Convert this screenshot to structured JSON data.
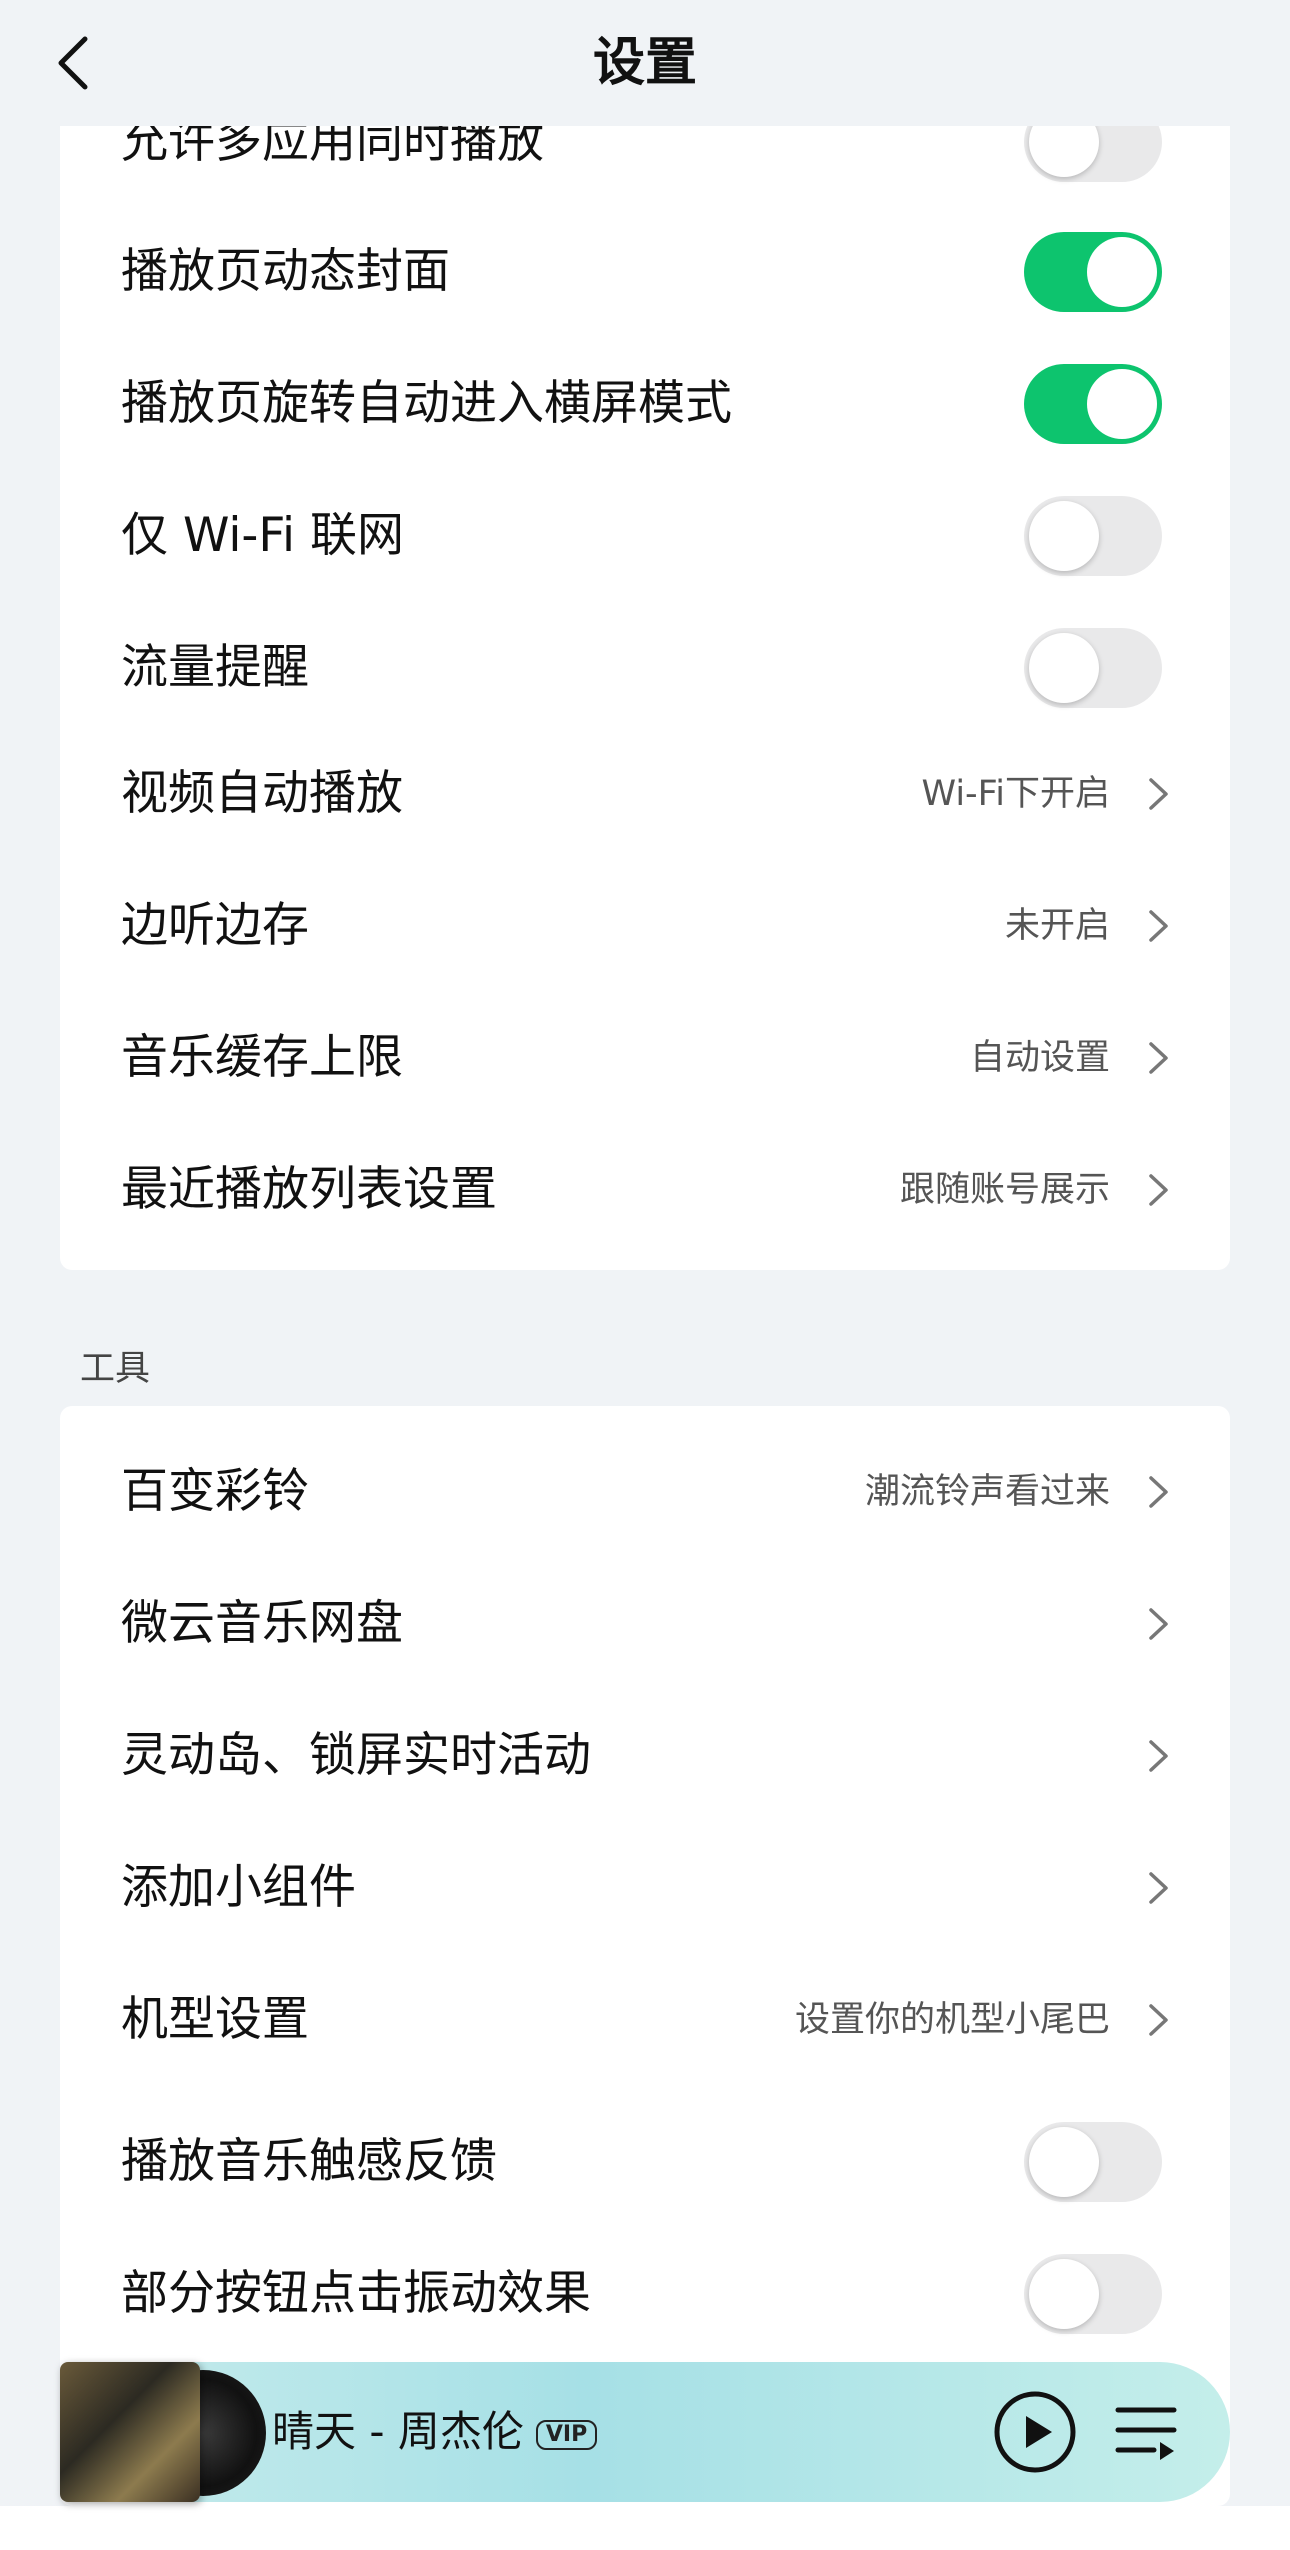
{
  "header": {
    "title": "设置"
  },
  "playback_settings": [
    {
      "label": "允许多应用同时播放",
      "type": "toggle",
      "on": false
    },
    {
      "label": "播放页动态封面",
      "type": "toggle",
      "on": true
    },
    {
      "label": "播放页旋转自动进入横屏模式",
      "type": "toggle",
      "on": true
    },
    {
      "label": "仅 Wi-Fi 联网",
      "type": "toggle",
      "on": false
    },
    {
      "label": "流量提醒",
      "type": "toggle",
      "on": false
    },
    {
      "label": "视频自动播放",
      "type": "nav",
      "value": "Wi-Fi下开启"
    },
    {
      "label": "边听边存",
      "type": "nav",
      "value": "未开启"
    },
    {
      "label": "音乐缓存上限",
      "type": "nav",
      "value": "自动设置"
    },
    {
      "label": "最近播放列表设置",
      "type": "nav",
      "value": "跟随账号展示"
    }
  ],
  "tools_section": {
    "title": "工具",
    "items": [
      {
        "label": "百变彩铃",
        "type": "nav",
        "value": "潮流铃声看过来"
      },
      {
        "label": "微云音乐网盘",
        "type": "nav",
        "value": ""
      },
      {
        "label": "灵动岛、锁屏实时活动",
        "type": "nav",
        "value": ""
      },
      {
        "label": "添加小组件",
        "type": "nav",
        "value": ""
      },
      {
        "label": "机型设置",
        "type": "nav",
        "value": "设置你的机型小尾巴"
      },
      {
        "label": "播放音乐触感反馈",
        "type": "toggle",
        "on": false
      },
      {
        "label": "部分按钮点击振动效果",
        "type": "toggle",
        "on": false
      }
    ]
  },
  "mini_player": {
    "song": "晴天 - 周杰伦",
    "badge": "VIP",
    "play_icon": "play-icon",
    "queue_icon": "playlist-icon"
  },
  "colors": {
    "accent_green": "#0dc46e",
    "toggle_off": "#e9e9ea",
    "background": "#f0f3f6"
  }
}
